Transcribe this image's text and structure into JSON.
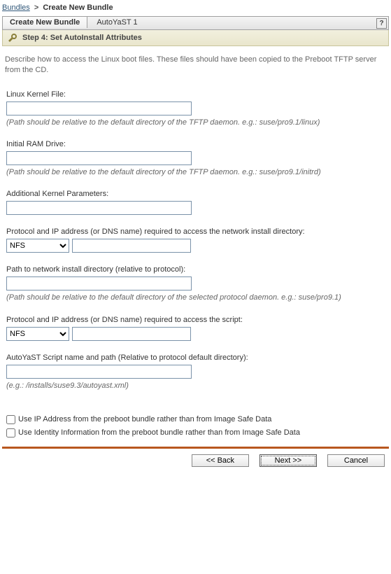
{
  "breadcrumb": {
    "root": "Bundles",
    "current": "Create New Bundle"
  },
  "tabs": {
    "main": "Create New Bundle",
    "sub": "AutoYaST 1"
  },
  "step": {
    "label": "Step 4: Set AutoInstall Attributes"
  },
  "description": "Describe how to access the Linux boot files. These files should have been copied to the Preboot TFTP server from the CD.",
  "fields": {
    "kernel": {
      "label": "Linux Kernel File:",
      "value": "",
      "hint": "(Path should be relative to the default directory of the TFTP daemon. e.g.: suse/pro9.1/linux)"
    },
    "ram": {
      "label": "Initial RAM Drive:",
      "value": "",
      "hint": "(Path should be relative to the default directory of the TFTP daemon. e.g.: suse/pro9.1/initrd)"
    },
    "params": {
      "label": "Additional Kernel Parameters:",
      "value": ""
    },
    "proto1": {
      "label": "Protocol and IP address (or DNS name) required to access the network install directory:",
      "select": "NFS",
      "ip": ""
    },
    "path1": {
      "label": "Path to network install directory (relative to protocol):",
      "value": "",
      "hint": "(Path should be relative to the default directory of the selected protocol daemon. e.g.: suse/pro9.1)"
    },
    "proto2": {
      "label": "Protocol and IP address (or DNS name) required to access the script:",
      "select": "NFS",
      "ip": ""
    },
    "script": {
      "label": "AutoYaST Script name and path (Relative to protocol default directory):",
      "value": "",
      "hint": "(e.g.: /installs/suse9.3/autoyast.xml)"
    }
  },
  "checks": {
    "ip": "Use IP Address from the preboot bundle rather than from Image Safe Data",
    "identity": "Use Identity Information from the preboot bundle rather than from Image Safe Data"
  },
  "buttons": {
    "back": "<< Back",
    "next": "Next >>",
    "cancel": "Cancel"
  }
}
